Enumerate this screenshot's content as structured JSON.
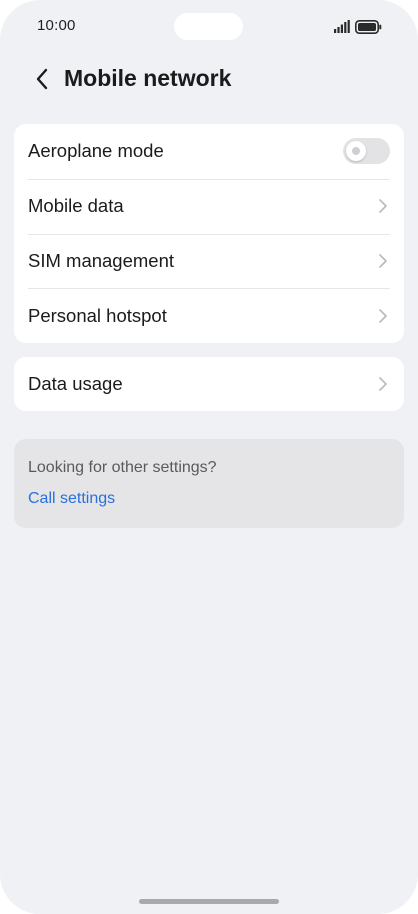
{
  "status_bar": {
    "time": "10:00",
    "icons": [
      "signal-icon",
      "battery-icon"
    ]
  },
  "header": {
    "back_icon": "back-arrow-icon",
    "title": "Mobile network"
  },
  "network_group": {
    "items": [
      {
        "label": "Aeroplane mode",
        "control": "toggle",
        "toggle_on": false
      },
      {
        "label": "Mobile data",
        "control": "chevron"
      },
      {
        "label": "SIM management",
        "control": "chevron"
      },
      {
        "label": "Personal hotspot",
        "control": "chevron"
      }
    ]
  },
  "usage_group": {
    "items": [
      {
        "label": "Data usage",
        "control": "chevron"
      }
    ]
  },
  "suggestion": {
    "text": "Looking for other settings?",
    "link": "Call settings"
  },
  "colors": {
    "background": "#f0f1f5",
    "card": "#ffffff",
    "link": "#2a6fdb",
    "suggestion_bg": "#e5e5e7"
  }
}
